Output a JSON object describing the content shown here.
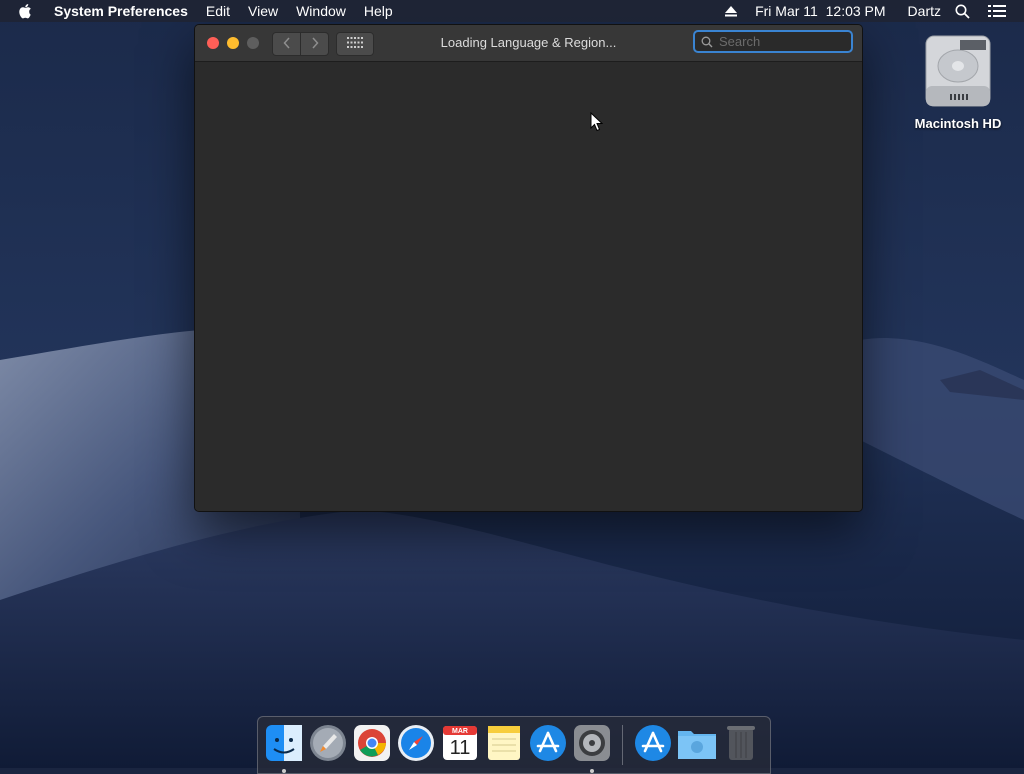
{
  "menubar": {
    "apple_icon": "apple-logo-icon",
    "app_name": "System Preferences",
    "menus": [
      "Edit",
      "View",
      "Window",
      "Help"
    ],
    "status": {
      "eject_icon": "eject-icon",
      "clock": "Fri Mar 11  12:03 PM",
      "user": "Dartz",
      "spotlight_icon": "search-icon",
      "notification_icon": "notification-list-icon"
    }
  },
  "desktop": {
    "icons": [
      {
        "label": "Macintosh HD",
        "icon": "hard-drive-icon"
      }
    ]
  },
  "window": {
    "title": "Loading Language & Region...",
    "search": {
      "placeholder": "Search",
      "value": ""
    },
    "buttons": {
      "back": "chevron-left-icon",
      "forward": "chevron-right-icon",
      "show_all": "grid-icon"
    }
  },
  "dock": {
    "apps": [
      {
        "name": "Finder",
        "icon": "finder-icon",
        "running": true
      },
      {
        "name": "Launchpad",
        "icon": "rocket-icon",
        "running": false
      },
      {
        "name": "Google Chrome",
        "icon": "chrome-icon",
        "running": false
      },
      {
        "name": "Safari",
        "icon": "compass-icon",
        "running": false
      },
      {
        "name": "Calendar",
        "icon": "calendar-icon",
        "running": false,
        "month": "MAR",
        "day": "11"
      },
      {
        "name": "Notes",
        "icon": "notes-icon",
        "running": false
      },
      {
        "name": "App Store",
        "icon": "app-store-icon",
        "running": false
      },
      {
        "name": "System Preferences",
        "icon": "gear-icon",
        "running": true
      },
      {
        "name": "App Store Downloads",
        "icon": "app-store-icon",
        "running": false
      },
      {
        "name": "Downloads",
        "icon": "folder-icon",
        "running": false
      },
      {
        "name": "Trash",
        "icon": "trash-icon",
        "running": false
      }
    ]
  },
  "colors": {
    "accent": "#3a84d2",
    "close": "#fe5f57",
    "minimize": "#febc2e",
    "window_bg": "#2b2b2b"
  }
}
